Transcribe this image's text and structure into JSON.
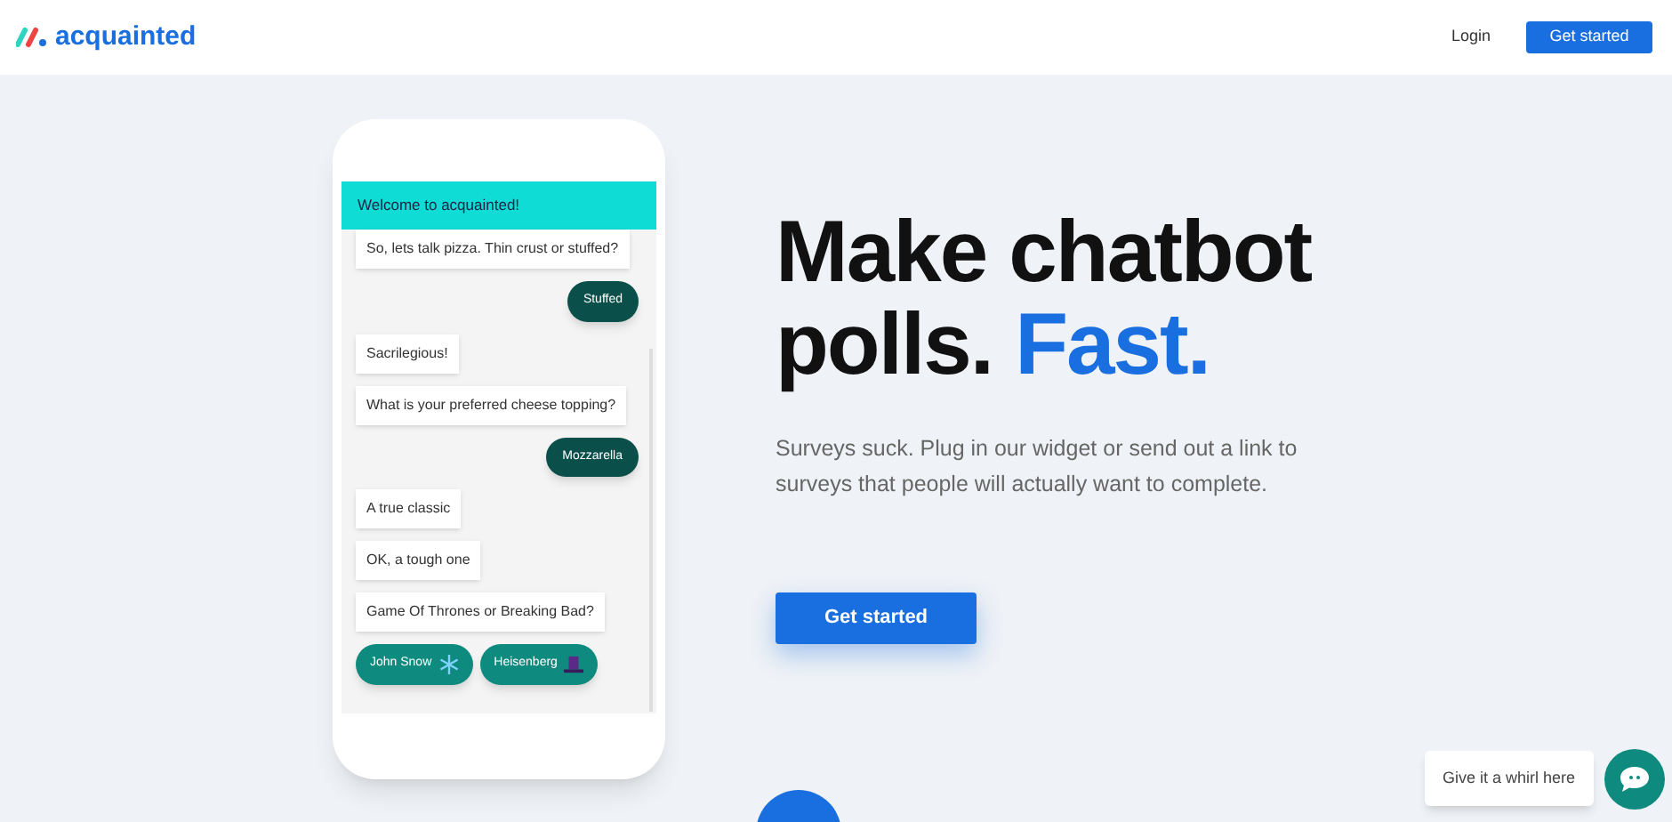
{
  "header": {
    "logo": "acquainted",
    "login": "Login",
    "cta": "Get started"
  },
  "phone": {
    "chat_title": "Welcome to acquainted!",
    "messages": [
      {
        "kind": "bot",
        "text": "So, lets talk pizza. Thin crust or stuffed?"
      },
      {
        "kind": "user",
        "text": "Stuffed"
      },
      {
        "kind": "bot",
        "text": "Sacrilegious!"
      },
      {
        "kind": "bot",
        "text": "What is your preferred cheese topping?"
      },
      {
        "kind": "user",
        "text": "Mozzarella"
      },
      {
        "kind": "bot",
        "text": "A true classic"
      },
      {
        "kind": "bot",
        "text": "OK, a tough one"
      },
      {
        "kind": "bot",
        "text": "Game Of Thrones or Breaking Bad?"
      },
      {
        "kind": "choices",
        "options": [
          {
            "text": "John Snow"
          },
          {
            "text": "Heisenberg"
          }
        ]
      }
    ]
  },
  "hero": {
    "title_line1": "Make chatbot",
    "title_line2": "polls.",
    "title_accent": "Fast.",
    "subtitle": "Surveys suck. Plug in our widget or send out a link to surveys that people will actually want to complete.",
    "cta": "Get started"
  },
  "widget": {
    "prompt": "Give it a whirl here"
  }
}
